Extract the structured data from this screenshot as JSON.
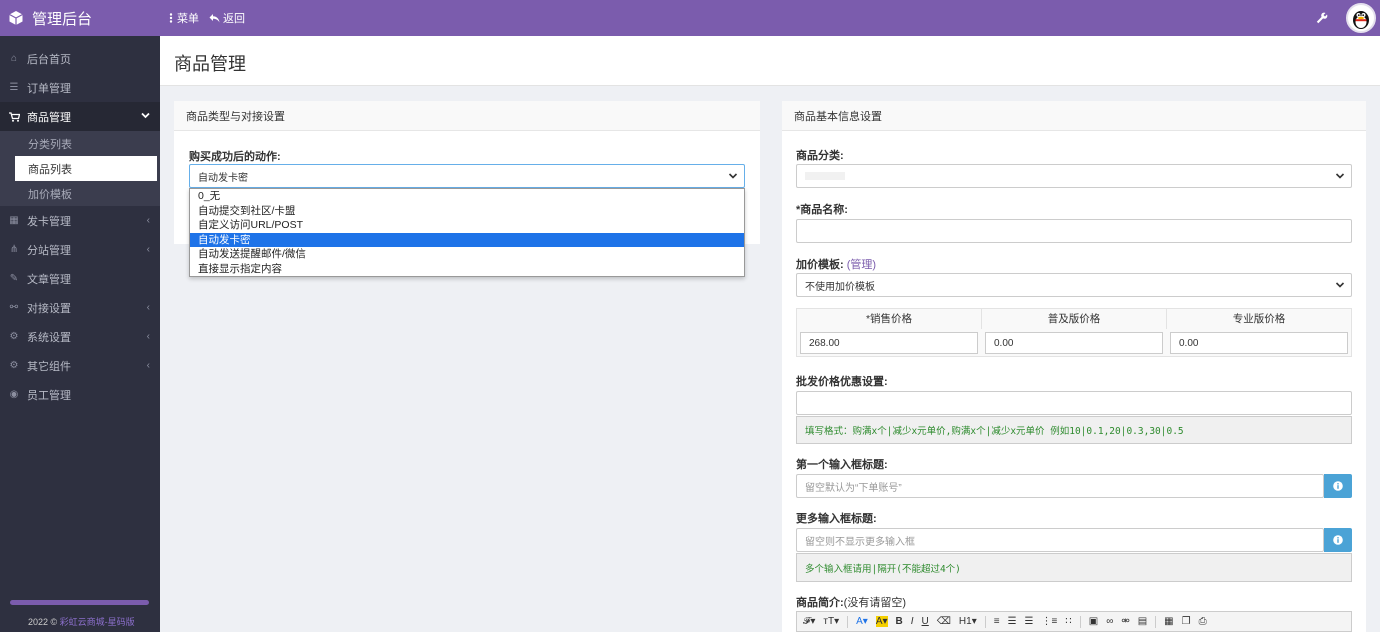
{
  "topbar": {
    "brand": "管理后台",
    "menu_label": "菜单",
    "back_label": "返回"
  },
  "sidebar": {
    "items": [
      {
        "label": "后台首页",
        "icon": "home-icon"
      },
      {
        "label": "订单管理",
        "icon": "list-icon"
      },
      {
        "label": "商品管理",
        "icon": "cart-icon",
        "active": true
      },
      {
        "label": "发卡管理",
        "icon": "grid-icon"
      },
      {
        "label": "分站管理",
        "icon": "sitemap-icon"
      },
      {
        "label": "文章管理",
        "icon": "edit-icon"
      },
      {
        "label": "对接设置",
        "icon": "link-icon"
      },
      {
        "label": "系统设置",
        "icon": "gear-icon"
      },
      {
        "label": "其它组件",
        "icon": "cogs-icon"
      },
      {
        "label": "员工管理",
        "icon": "user-icon"
      }
    ],
    "sub_items": [
      {
        "label": "分类列表"
      },
      {
        "label": "商品列表",
        "current": true
      },
      {
        "label": "加价模板"
      }
    ],
    "footer_year": "2022 ©",
    "footer_link": "彩虹云商城-星码版"
  },
  "page": {
    "title": "商品管理"
  },
  "left_panel": {
    "title": "商品类型与对接设置",
    "action_label": "购买成功后的动作:",
    "action_value": "自动发卡密",
    "options": [
      "0_无",
      "自动提交到社区/卡盟",
      "自定义访问URL/POST",
      "自动发卡密",
      "自动发送提醒邮件/微信",
      "直接显示指定内容"
    ],
    "selected_index": 3
  },
  "right_panel": {
    "title": "商品基本信息设置",
    "category_label": "商品分类:",
    "name_label": "*商品名称:",
    "markup_label": "加价模板:",
    "markup_link": "(管理)",
    "markup_value": "不使用加价模板",
    "price_headers": [
      "*销售价格",
      "普及版价格",
      "专业版价格"
    ],
    "prices": [
      "268.00",
      "0.00",
      "0.00"
    ],
    "bulk_label": "批发价格优惠设置:",
    "bulk_hint": "填写格式：购满x个|减少x元单价,购满x个|减少x元单价  例如10|0.1,20|0.3,30|0.5",
    "first_input_label": "第一个输入框标题:",
    "first_input_placeholder": "留空默认为“下单账号”",
    "more_input_label": "更多输入框标题:",
    "more_input_placeholder": "留空则不显示更多输入框",
    "more_input_hint": "多个输入框请用|隔开(不能超过4个)",
    "intro_label": "商品简介:",
    "intro_note": "(没有请留空)"
  },
  "editor": {
    "tools": [
      "𝓕▾",
      "ᴛT▾",
      "A▾",
      "A▾",
      "B",
      "I",
      "U",
      "⌫",
      "H1▾",
      "≡"
    ]
  },
  "colors": {
    "accent": "#7b5cad",
    "sidebar_bg": "#2e3040",
    "selected_option": "#1e73e8",
    "hint_text": "#2e8b2e",
    "info_button": "#4ba3d6"
  }
}
